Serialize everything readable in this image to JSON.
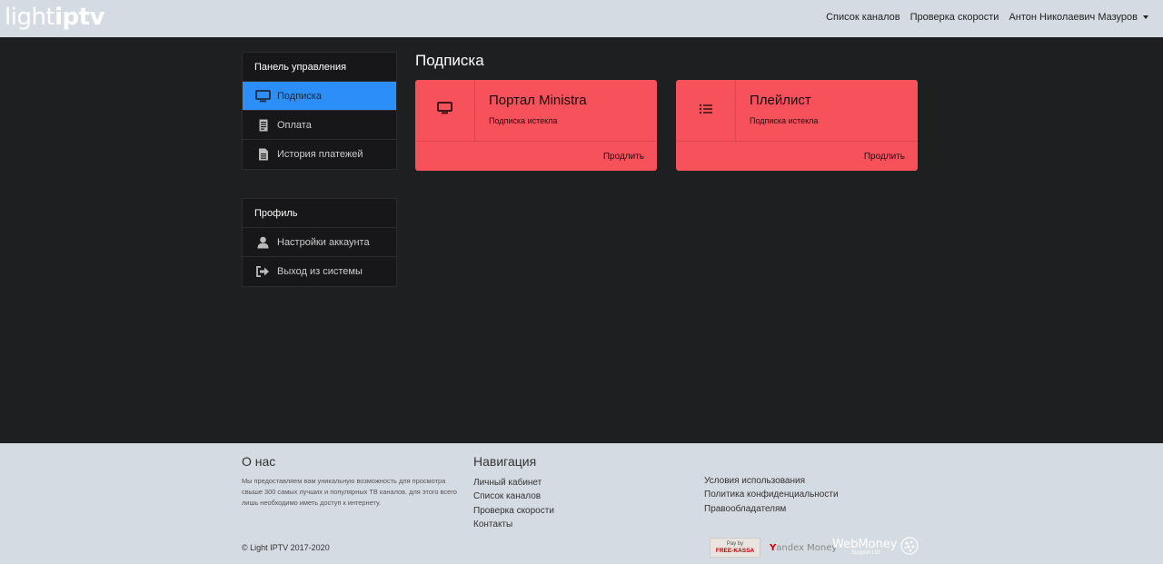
{
  "header": {
    "logo_light": "light",
    "logo_iptv": "iptv",
    "nav": [
      "Список каналов",
      "Проверка скорости"
    ],
    "user_name": "Антон Николаевич Мазуров"
  },
  "sidebar": {
    "panel_title": "Панель управления",
    "items": [
      {
        "label": "Подписка",
        "icon": "monitor-icon",
        "active": true
      },
      {
        "label": "Оплата",
        "icon": "receipt-icon",
        "active": false
      },
      {
        "label": "История платежей",
        "icon": "document-icon",
        "active": false
      }
    ],
    "profile_title": "Профиль",
    "profile_items": [
      {
        "label": "Настройки аккаунта",
        "icon": "user-icon"
      },
      {
        "label": "Выход из системы",
        "icon": "sign-out-icon"
      }
    ]
  },
  "main": {
    "title": "Подписка",
    "cards": [
      {
        "title": "Портал Ministra",
        "status": "Подписка истекла",
        "action": "Продлить",
        "icon": "monitor-icon"
      },
      {
        "title": "Плейлист",
        "status": "Подписка истекла",
        "action": "Продлить",
        "icon": "list-icon"
      }
    ]
  },
  "footer": {
    "about_title": "О нас",
    "about_text": "Мы предоставляем вам уникальную возможность для просмотра свыше 300 самых лучших и популярных ТВ каналов. для этого всего лишь необходимо иметь доступ к интернету.",
    "nav_title": "Навигация",
    "nav_links": [
      "Личный кабинет",
      "Список каналов",
      "Проверка скорости",
      "Контакты"
    ],
    "legal_links": [
      "Условия использования",
      "Политика конфиденциальности",
      "Правообладателям"
    ],
    "copyright": "© Light IPTV 2017-2020",
    "payments": {
      "freekassa_top": "Pay by",
      "freekassa_bottom": "FREE-KASSA",
      "yandex_y": "Y",
      "yandex_rest": "andex Money",
      "webmoney": "WebMoney",
      "webmoney_sub": "Support Ltd"
    }
  },
  "colors": {
    "active_blue": "#2c8ef8",
    "card_red": "#f7515b",
    "header_bg": "#d5dbe2",
    "body_bg": "#1e1f21"
  }
}
